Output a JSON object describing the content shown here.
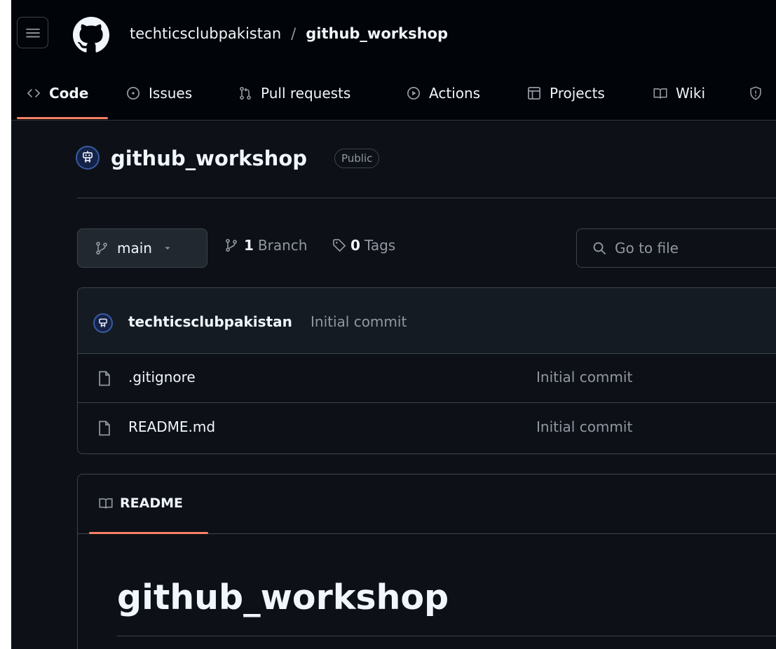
{
  "header": {
    "owner": "techticsclubpakistan",
    "separator": "/",
    "repo": "github_workshop"
  },
  "tabs": [
    {
      "label": "Code",
      "icon": "code-icon",
      "active": true
    },
    {
      "label": "Issues",
      "icon": "issue-icon"
    },
    {
      "label": "Pull requests",
      "icon": "pull-request-icon"
    },
    {
      "label": "Actions",
      "icon": "play-icon"
    },
    {
      "label": "Projects",
      "icon": "table-icon"
    },
    {
      "label": "Wiki",
      "icon": "book-icon"
    },
    {
      "label": "",
      "icon": "shield-icon"
    }
  ],
  "repo": {
    "title": "github_workshop",
    "visibility": "Public"
  },
  "branch": {
    "current": "main",
    "branch_count": "1",
    "branch_label": "Branch",
    "tag_count": "0",
    "tag_label": "Tags",
    "goto_placeholder": "Go to file"
  },
  "latest_commit": {
    "author": "techticsclubpakistan",
    "message": "Initial commit"
  },
  "files": [
    {
      "name": ".gitignore",
      "commit": "Initial commit"
    },
    {
      "name": "README.md",
      "commit": "Initial commit"
    }
  ],
  "readme": {
    "tab_label": "README",
    "heading": "github_workshop"
  },
  "colors": {
    "background": "#0d1117",
    "header": "#010409",
    "accent_underline": "#f78166",
    "border": "#3d444d",
    "muted_text": "#9198a1"
  }
}
